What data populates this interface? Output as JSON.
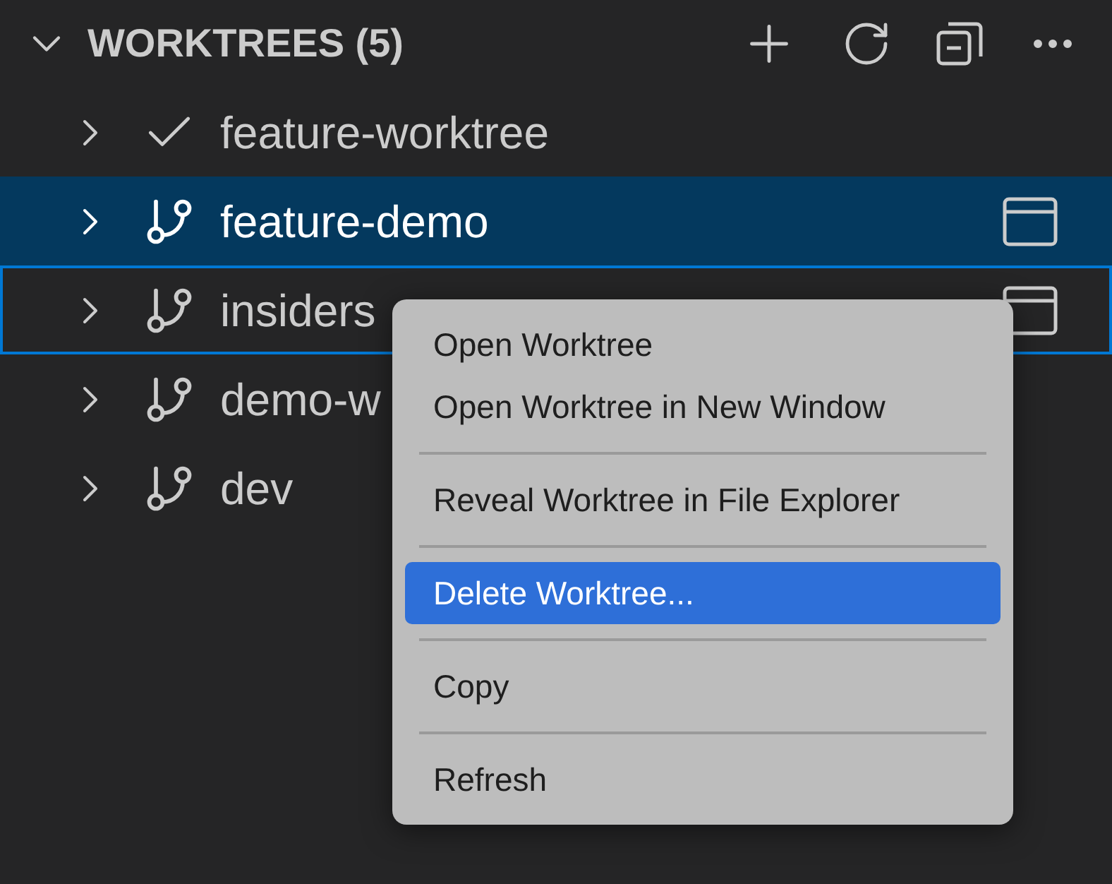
{
  "section": {
    "title": "WORKTREES (5)",
    "expanded": true
  },
  "rows": [
    {
      "label": "feature-worktree",
      "kind": "current",
      "selected": false,
      "focused": false,
      "show_action": false
    },
    {
      "label": "feature-demo",
      "kind": "branch",
      "selected": true,
      "focused": false,
      "show_action": true
    },
    {
      "label": "insiders",
      "kind": "branch",
      "selected": false,
      "focused": true,
      "show_action": true
    },
    {
      "label": "demo-w",
      "kind": "branch",
      "selected": false,
      "focused": false,
      "show_action": false
    },
    {
      "label": "dev",
      "kind": "branch",
      "selected": false,
      "focused": false,
      "show_action": false
    }
  ],
  "context_menu": {
    "groups": [
      [
        {
          "label": "Open Worktree",
          "selected": false
        },
        {
          "label": "Open Worktree in New Window",
          "selected": false
        }
      ],
      [
        {
          "label": "Reveal Worktree in File Explorer",
          "selected": false
        }
      ],
      [
        {
          "label": "Delete Worktree...",
          "selected": true
        }
      ],
      [
        {
          "label": "Copy",
          "selected": false
        }
      ],
      [
        {
          "label": "Refresh",
          "selected": false
        }
      ]
    ]
  }
}
